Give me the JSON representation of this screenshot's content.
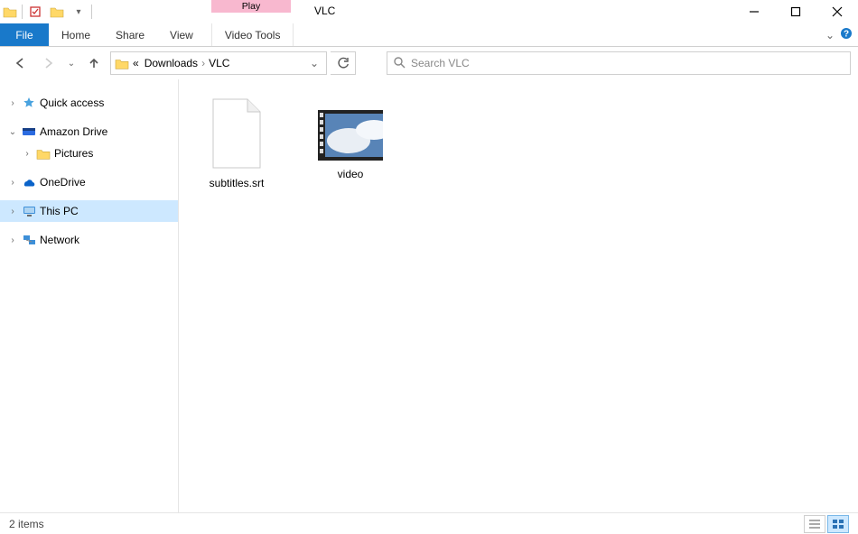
{
  "title": "VLC",
  "context_tab_label": "Play",
  "ribbon": {
    "file": "File",
    "tabs": [
      "Home",
      "Share",
      "View"
    ],
    "context": "Video Tools"
  },
  "nav": {
    "breadcrumbs": [
      "Downloads",
      "VLC"
    ],
    "breadcrumb_prefix": "«"
  },
  "search": {
    "placeholder": "Search VLC"
  },
  "sidebar": [
    {
      "label": "Quick access",
      "icon": "star-icon",
      "expander": "›"
    },
    {
      "label": "Amazon Drive",
      "icon": "amazon-drive-icon",
      "expander": "⌄"
    },
    {
      "label": "Pictures",
      "icon": "folder-icon",
      "child": true,
      "expander": "›"
    },
    {
      "label": "OneDrive",
      "icon": "onedrive-icon",
      "expander": "›"
    },
    {
      "label": "This PC",
      "icon": "pc-icon",
      "expander": "›",
      "selected": true
    },
    {
      "label": "Network",
      "icon": "network-icon",
      "expander": "›"
    }
  ],
  "files": [
    {
      "label": "subtitles.srt",
      "type": "text"
    },
    {
      "label": "video",
      "type": "video"
    }
  ],
  "status": {
    "text": "2 items"
  }
}
